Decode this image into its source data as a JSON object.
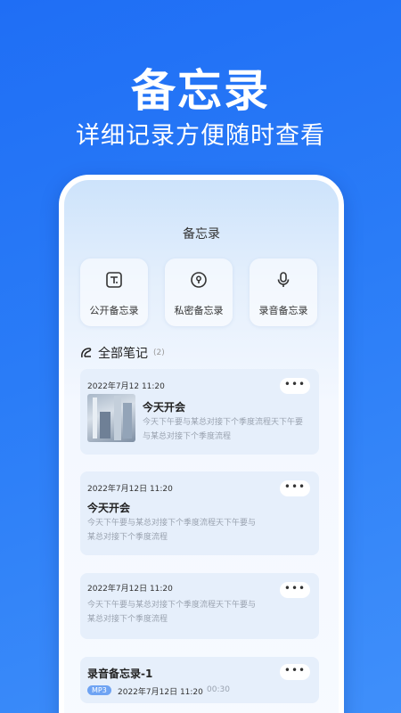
{
  "hero": {
    "title": "备忘录",
    "subtitle": "详细记录方便随时查看"
  },
  "app": {
    "title": "备忘录",
    "categories": [
      {
        "label": "公开备忘录",
        "icon": "text-icon"
      },
      {
        "label": "私密备忘录",
        "icon": "lock-icon"
      },
      {
        "label": "录音备忘录",
        "icon": "microphone-icon"
      }
    ],
    "section": {
      "label": "全部笔记",
      "count": "(2)",
      "icon": "note-icon"
    },
    "notes": [
      {
        "date": "2022年7月12  11:20",
        "title": "今天开会",
        "body": "今天下午要与某总对接下个季度流程天下午要与某总对接下个季度流程",
        "has_image": true,
        "more": "•••"
      },
      {
        "date": "2022年7月12日  11:20",
        "title": "今天开会",
        "body": "今天下午要与某总对接下个季度流程天下午要与某总对接下个季度流程",
        "more": "•••"
      },
      {
        "date": "2022年7月12日  11:20",
        "body": "今天下午要与某总对接下个季度流程天下午要与某总对接下个季度流程",
        "more": "•••"
      }
    ],
    "recording": {
      "title": "录音备忘录-1",
      "badge": "MP3",
      "date": "2022年7月12日  11:20",
      "duration": "00:30",
      "more": "•••"
    }
  },
  "colors": {
    "background": "#2a7cf7",
    "badge": "#6ea3f3"
  }
}
